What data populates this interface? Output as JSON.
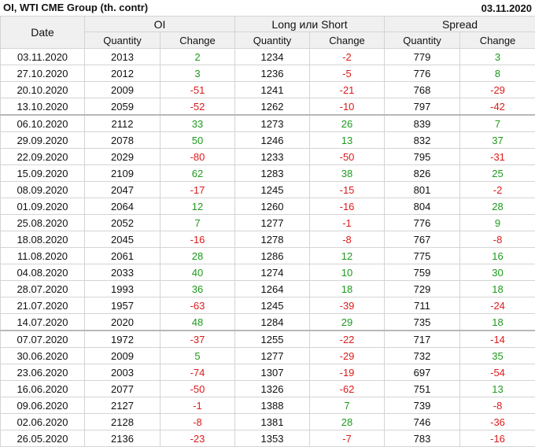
{
  "header": {
    "title": "OI, WTI CME Group (th. contr)",
    "date": "03.11.2020"
  },
  "columns": {
    "date": "Date",
    "groups": [
      "OI",
      "Long или Short",
      "Spread"
    ],
    "quantity": "Quantity",
    "change": "Change"
  },
  "colors": {
    "positive": "#1e9a1e",
    "negative": "#dd1b1b",
    "header_bg": "#f0f0f0",
    "border": "#d4d4d4"
  },
  "separator_after_rows": [
    3,
    16
  ],
  "rows": [
    {
      "date": "03.11.2020",
      "oi_qty": "2013",
      "oi_chg": "2",
      "ls_qty": "1234",
      "ls_chg": "-2",
      "sp_qty": "779",
      "sp_chg": "3"
    },
    {
      "date": "27.10.2020",
      "oi_qty": "2012",
      "oi_chg": "3",
      "ls_qty": "1236",
      "ls_chg": "-5",
      "sp_qty": "776",
      "sp_chg": "8"
    },
    {
      "date": "20.10.2020",
      "oi_qty": "2009",
      "oi_chg": "-51",
      "ls_qty": "1241",
      "ls_chg": "-21",
      "sp_qty": "768",
      "sp_chg": "-29"
    },
    {
      "date": "13.10.2020",
      "oi_qty": "2059",
      "oi_chg": "-52",
      "ls_qty": "1262",
      "ls_chg": "-10",
      "sp_qty": "797",
      "sp_chg": "-42"
    },
    {
      "date": "06.10.2020",
      "oi_qty": "2112",
      "oi_chg": "33",
      "ls_qty": "1273",
      "ls_chg": "26",
      "sp_qty": "839",
      "sp_chg": "7"
    },
    {
      "date": "29.09.2020",
      "oi_qty": "2078",
      "oi_chg": "50",
      "ls_qty": "1246",
      "ls_chg": "13",
      "sp_qty": "832",
      "sp_chg": "37"
    },
    {
      "date": "22.09.2020",
      "oi_qty": "2029",
      "oi_chg": "-80",
      "ls_qty": "1233",
      "ls_chg": "-50",
      "sp_qty": "795",
      "sp_chg": "-31"
    },
    {
      "date": "15.09.2020",
      "oi_qty": "2109",
      "oi_chg": "62",
      "ls_qty": "1283",
      "ls_chg": "38",
      "sp_qty": "826",
      "sp_chg": "25"
    },
    {
      "date": "08.09.2020",
      "oi_qty": "2047",
      "oi_chg": "-17",
      "ls_qty": "1245",
      "ls_chg": "-15",
      "sp_qty": "801",
      "sp_chg": "-2"
    },
    {
      "date": "01.09.2020",
      "oi_qty": "2064",
      "oi_chg": "12",
      "ls_qty": "1260",
      "ls_chg": "-16",
      "sp_qty": "804",
      "sp_chg": "28"
    },
    {
      "date": "25.08.2020",
      "oi_qty": "2052",
      "oi_chg": "7",
      "ls_qty": "1277",
      "ls_chg": "-1",
      "sp_qty": "776",
      "sp_chg": "9"
    },
    {
      "date": "18.08.2020",
      "oi_qty": "2045",
      "oi_chg": "-16",
      "ls_qty": "1278",
      "ls_chg": "-8",
      "sp_qty": "767",
      "sp_chg": "-8"
    },
    {
      "date": "11.08.2020",
      "oi_qty": "2061",
      "oi_chg": "28",
      "ls_qty": "1286",
      "ls_chg": "12",
      "sp_qty": "775",
      "sp_chg": "16"
    },
    {
      "date": "04.08.2020",
      "oi_qty": "2033",
      "oi_chg": "40",
      "ls_qty": "1274",
      "ls_chg": "10",
      "sp_qty": "759",
      "sp_chg": "30"
    },
    {
      "date": "28.07.2020",
      "oi_qty": "1993",
      "oi_chg": "36",
      "ls_qty": "1264",
      "ls_chg": "18",
      "sp_qty": "729",
      "sp_chg": "18"
    },
    {
      "date": "21.07.2020",
      "oi_qty": "1957",
      "oi_chg": "-63",
      "ls_qty": "1245",
      "ls_chg": "-39",
      "sp_qty": "711",
      "sp_chg": "-24"
    },
    {
      "date": "14.07.2020",
      "oi_qty": "2020",
      "oi_chg": "48",
      "ls_qty": "1284",
      "ls_chg": "29",
      "sp_qty": "735",
      "sp_chg": "18"
    },
    {
      "date": "07.07.2020",
      "oi_qty": "1972",
      "oi_chg": "-37",
      "ls_qty": "1255",
      "ls_chg": "-22",
      "sp_qty": "717",
      "sp_chg": "-14"
    },
    {
      "date": "30.06.2020",
      "oi_qty": "2009",
      "oi_chg": "5",
      "ls_qty": "1277",
      "ls_chg": "-29",
      "sp_qty": "732",
      "sp_chg": "35"
    },
    {
      "date": "23.06.2020",
      "oi_qty": "2003",
      "oi_chg": "-74",
      "ls_qty": "1307",
      "ls_chg": "-19",
      "sp_qty": "697",
      "sp_chg": "-54"
    },
    {
      "date": "16.06.2020",
      "oi_qty": "2077",
      "oi_chg": "-50",
      "ls_qty": "1326",
      "ls_chg": "-62",
      "sp_qty": "751",
      "sp_chg": "13"
    },
    {
      "date": "09.06.2020",
      "oi_qty": "2127",
      "oi_chg": "-1",
      "ls_qty": "1388",
      "ls_chg": "7",
      "sp_qty": "739",
      "sp_chg": "-8"
    },
    {
      "date": "02.06.2020",
      "oi_qty": "2128",
      "oi_chg": "-8",
      "ls_qty": "1381",
      "ls_chg": "28",
      "sp_qty": "746",
      "sp_chg": "-36"
    },
    {
      "date": "26.05.2020",
      "oi_qty": "2136",
      "oi_chg": "-23",
      "ls_qty": "1353",
      "ls_chg": "-7",
      "sp_qty": "783",
      "sp_chg": "-16"
    }
  ]
}
